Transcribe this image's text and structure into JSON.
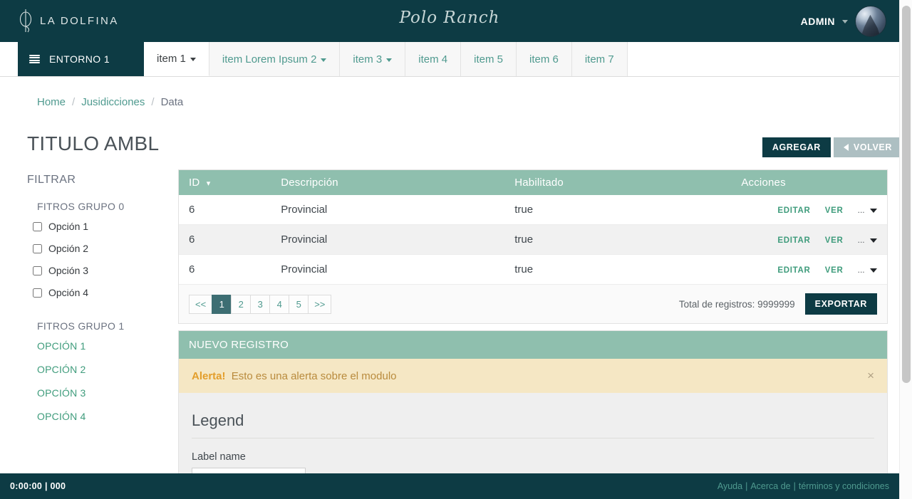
{
  "header": {
    "brand_name": "LA DOLFINA",
    "brand_logo_icon": "dolfina-monogram-icon",
    "center_logo_text": "Polo Ranch",
    "admin_label": "ADMIN",
    "admin_caret_icon": "chevron-down-icon",
    "avatar_icon": "user-avatar"
  },
  "nav": {
    "menu_icon": "hamburger-icon",
    "environment_label": "ENTORNO 1",
    "tabs": [
      {
        "label": "item 1",
        "active": true,
        "has_caret": true
      },
      {
        "label": "item Lorem Ipsum 2",
        "active": false,
        "has_caret": true
      },
      {
        "label": "item 3",
        "active": false,
        "has_caret": true
      },
      {
        "label": "item 4",
        "active": false,
        "has_caret": false
      },
      {
        "label": "item 5",
        "active": false,
        "has_caret": false
      },
      {
        "label": "item 6",
        "active": false,
        "has_caret": false
      },
      {
        "label": "item 7",
        "active": false,
        "has_caret": false
      }
    ]
  },
  "breadcrumb": {
    "items": [
      {
        "label": "Home",
        "link": true
      },
      {
        "label": "Jusidicciones",
        "link": true
      },
      {
        "label": "Data",
        "link": false
      }
    ],
    "separator": "/"
  },
  "page": {
    "title": "TITULO AMBL",
    "add_button": "AGREGAR",
    "back_button": "VOLVER",
    "back_icon": "chevron-left-icon"
  },
  "sidebar": {
    "title": "FILTRAR",
    "group0_title": "FITROS GRUPO 0",
    "checkboxes": [
      {
        "label": "Opción 1",
        "checked": false
      },
      {
        "label": "Opción 2",
        "checked": false
      },
      {
        "label": "Opción 3",
        "checked": false
      },
      {
        "label": "Opción 4",
        "checked": false
      }
    ],
    "group1_title": "FITROS GRUPO 1",
    "links": [
      {
        "label": "OPCIÓN 1"
      },
      {
        "label": "OPCIÓN 2"
      },
      {
        "label": "OPCIÓN 3"
      },
      {
        "label": "OPCIÓN 4"
      }
    ]
  },
  "table": {
    "columns": [
      "ID",
      "Descripción",
      "Habilitado",
      "Acciones"
    ],
    "sort_column": "ID",
    "sort_caret_icon": "caret-down-icon",
    "rows": [
      {
        "id": "6",
        "descripcion": "Provincial",
        "habilitado": "true"
      },
      {
        "id": "6",
        "descripcion": "Provincial",
        "habilitado": "true"
      },
      {
        "id": "6",
        "descripcion": "Provincial",
        "habilitado": "true"
      }
    ],
    "actions": {
      "edit_label": "EDITAR",
      "view_label": "VER",
      "more_label": "...",
      "more_caret_icon": "caret-down-icon"
    }
  },
  "pagination": {
    "first_label": "<<",
    "last_label": ">>",
    "pages": [
      "1",
      "2",
      "3",
      "4",
      "5"
    ],
    "active_page": "1",
    "total_text": "Total de registros: 9999999",
    "export_button": "EXPORTAR"
  },
  "new_record": {
    "panel_title": "NUEVO REGISTRO",
    "alert_strong": "Alerta!",
    "alert_text": "Esto es una alerta sobre el modulo",
    "alert_close_icon": "close-icon",
    "legend_title": "Legend",
    "field_label": "Label name",
    "field_value": "",
    "field_placeholder": ""
  },
  "footer": {
    "left_text": "0:00:00 | 000",
    "links": [
      "Ayuda",
      "Acerca de",
      "términos y condiciones"
    ],
    "separator": "|"
  },
  "colors": {
    "brand_dark": "#0d3b44",
    "accent_green": "#8fbfae",
    "link_teal": "#4f9a8f",
    "link_green": "#3f9c7c",
    "alert_bg": "#f5e7c4",
    "alert_strong": "#e39e2b",
    "pager_active": "#3d6e73",
    "muted_button": "#adbfc2"
  }
}
